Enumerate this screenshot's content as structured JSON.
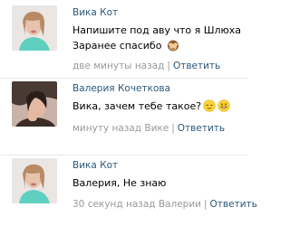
{
  "comments": [
    {
      "author": "Вика Кот",
      "lines": [
        "Напишите под аву что я Шлюха",
        "Заранее спасибо"
      ],
      "emoji": "monkey-see-no-evil",
      "time": "две минуты назад",
      "reply_label": "Ответить"
    },
    {
      "author": "Валерия Кочеткова",
      "lines": [
        "Вика, зачем тебе такое?"
      ],
      "emoji": "relieved-face, grinning-face",
      "time": "минуту назад Вике",
      "reply_label": "Ответить"
    },
    {
      "author": "Вика Кот",
      "lines": [
        "Валерия, Не знаю"
      ],
      "time": "30 секунд назад Валерии",
      "reply_label": "Ответить"
    }
  ],
  "separator": "|",
  "colors": {
    "link": "#2b587a",
    "meta": "#999999",
    "divider": "#e7eaed"
  }
}
